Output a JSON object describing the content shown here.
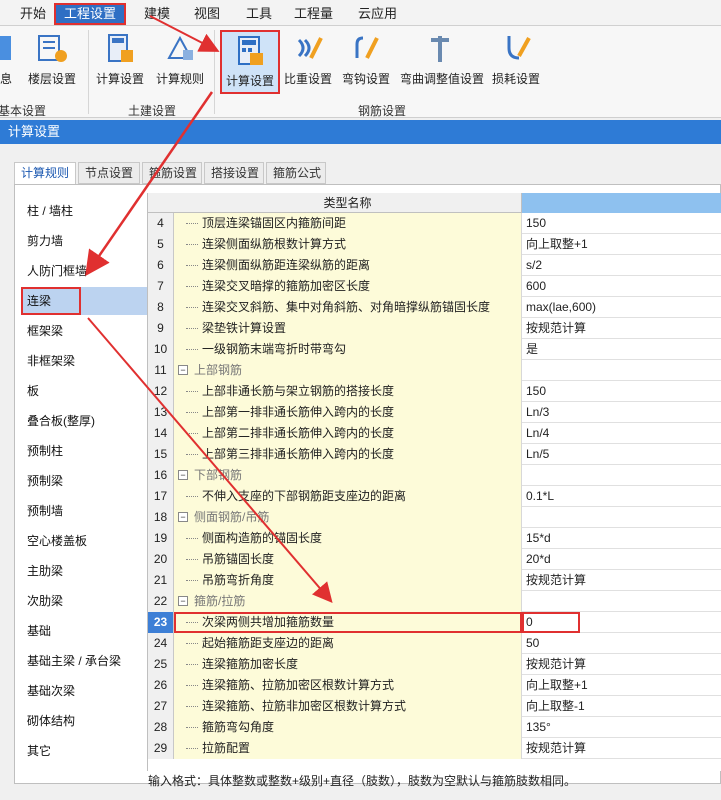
{
  "menu": [
    "开始",
    "工程设置",
    "建模",
    "视图",
    "工具",
    "工程量",
    "云应用"
  ],
  "ribbon": {
    "buttons": [
      "信息",
      "楼层设置",
      "计算设置",
      "计算规则",
      "计算设置",
      "比重设置",
      "弯钩设置",
      "弯曲调整值设置",
      "损耗设置"
    ],
    "groups": [
      "基本设置",
      "土建设置",
      "钢筋设置"
    ]
  },
  "window_title": "计算设置",
  "tabs": [
    "计算规则",
    "节点设置",
    "箍筋设置",
    "搭接设置",
    "箍筋公式"
  ],
  "left_list": [
    "柱 / 墙柱",
    "剪力墙",
    "人防门框墙",
    "连梁",
    "框架梁",
    "非框架梁",
    "板",
    "叠合板(整厚)",
    "预制柱",
    "预制梁",
    "预制墙",
    "空心楼盖板",
    "主肋梁",
    "次肋梁",
    "基础",
    "基础主梁 / 承台梁",
    "基础次梁",
    "砌体结构",
    "其它"
  ],
  "grid": {
    "header_name": "类型名称",
    "rows": [
      {
        "num": "4",
        "name": "顶层连梁锚固区内箍筋间距",
        "value": "150"
      },
      {
        "num": "5",
        "name": "连梁侧面纵筋根数计算方式",
        "value": "向上取整+1"
      },
      {
        "num": "6",
        "name": "连梁侧面纵筋距连梁纵筋的距离",
        "value": "s/2"
      },
      {
        "num": "7",
        "name": "连梁交叉暗撑的箍筋加密区长度",
        "value": "600"
      },
      {
        "num": "8",
        "name": "连梁交叉斜筋、集中对角斜筋、对角暗撑纵筋锚固长度",
        "value": "max(lae,600)"
      },
      {
        "num": "9",
        "name": "梁垫铁计算设置",
        "value": "按规范计算"
      },
      {
        "num": "10",
        "name": "一级钢筋末端弯折时带弯勾",
        "value": "是"
      },
      {
        "num": "11",
        "name": "上部钢筋",
        "value": "",
        "group": true
      },
      {
        "num": "12",
        "name": "上部非通长筋与架立钢筋的搭接长度",
        "value": "150"
      },
      {
        "num": "13",
        "name": "上部第一排非通长筋伸入跨内的长度",
        "value": "Ln/3"
      },
      {
        "num": "14",
        "name": "上部第二排非通长筋伸入跨内的长度",
        "value": "Ln/4"
      },
      {
        "num": "15",
        "name": "上部第三排非通长筋伸入跨内的长度",
        "value": "Ln/5"
      },
      {
        "num": "16",
        "name": "下部钢筋",
        "value": "",
        "group": true
      },
      {
        "num": "17",
        "name": "不伸入支座的下部钢筋距支座边的距离",
        "value": "0.1*L"
      },
      {
        "num": "18",
        "name": "侧面钢筋/吊筋",
        "value": "",
        "group": true
      },
      {
        "num": "19",
        "name": "侧面构造筋的锚固长度",
        "value": "15*d"
      },
      {
        "num": "20",
        "name": "吊筋锚固长度",
        "value": "20*d"
      },
      {
        "num": "21",
        "name": "吊筋弯折角度",
        "value": "按规范计算"
      },
      {
        "num": "22",
        "name": "箍筋/拉筋",
        "value": "",
        "group": true
      },
      {
        "num": "23",
        "name": "次梁两侧共增加箍筋数量",
        "value": "0",
        "active": true
      },
      {
        "num": "24",
        "name": "起始箍筋距支座边的距离",
        "value": "50"
      },
      {
        "num": "25",
        "name": "连梁箍筋加密长度",
        "value": "按规范计算"
      },
      {
        "num": "26",
        "name": "连梁箍筋、拉筋加密区根数计算方式",
        "value": "向上取整+1"
      },
      {
        "num": "27",
        "name": "连梁箍筋、拉筋非加密区根数计算方式",
        "value": "向上取整-1"
      },
      {
        "num": "28",
        "name": "箍筋弯勾角度",
        "value": "135°"
      },
      {
        "num": "29",
        "name": "拉筋配置",
        "value": "按规范计算"
      }
    ]
  },
  "footer_note": "输入格式：具体整数或整数+级别+直径（肢数），肢数为空默认与箍筋肢数相同。",
  "colors": {
    "accent": "#2e7bd6",
    "highlight": "#e03030",
    "cell_yellow": "#fdfbd9"
  }
}
